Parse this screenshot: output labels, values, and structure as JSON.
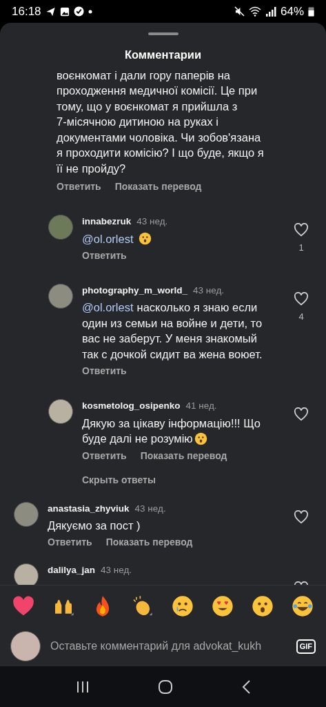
{
  "status_bar": {
    "time": "16:18",
    "battery": "64%"
  },
  "sheet": {
    "title": "Комментарии"
  },
  "comments": [
    {
      "lines": [
        "воєнкомат і дали гору паперів на",
        "проходження медичної комісії. Це при",
        "тому, що у воєнкомат я прийшла з",
        "7-місячною дитиною на руках і",
        "документами чоловіка. Чи зобов'язана",
        "я проходити комісію? І що буде, якщо я",
        "її не пройду?"
      ],
      "actions": [
        "Ответить",
        "Показать перевод"
      ],
      "replies": [
        {
          "username": "innabezruk",
          "time": "43 нед.",
          "mention": "@ol.orlest",
          "emoji": true,
          "actions": [
            "Ответить"
          ],
          "likes": "1"
        },
        {
          "username": "photography_m_world_",
          "time": "43 нед.",
          "mention": "@ol.orlest",
          "lines": [
            "насколько я знаю если",
            "один из семьи на войне и дети, то",
            "вас не заберут.  У меня знакомый",
            "так с дочкой сидит ва жена воюет."
          ],
          "actions": [
            "Ответить"
          ],
          "likes": "4"
        },
        {
          "username": "kosmetolog_osipenko",
          "time": "41 нед.",
          "lines": [
            "Дякую за цікаву інформацію!!! Що",
            "буде далі не розумію"
          ],
          "emoji": true,
          "actions": [
            "Ответить",
            "Показать перевод"
          ]
        }
      ],
      "hide_replies": "Скрыть ответы"
    },
    {
      "username": "anastasia_zhyviuk",
      "time": "43 нед.",
      "lines": [
        "Дякуємо за пост )"
      ],
      "actions": [
        "Ответить",
        "Показать перевод"
      ]
    },
    {
      "username": "dalilya_jan",
      "time": "43 нед."
    }
  ],
  "reactions": [
    {
      "kind": "heart"
    },
    {
      "kind": "raised-hands"
    },
    {
      "kind": "fire"
    },
    {
      "kind": "clapping"
    },
    {
      "kind": "crying"
    },
    {
      "kind": "heart-eyes"
    },
    {
      "kind": "surprised"
    },
    {
      "kind": "laughing"
    }
  ],
  "composer": {
    "placeholder": "Оставьте комментарий для advokat_kukh",
    "gif": "GIF"
  }
}
